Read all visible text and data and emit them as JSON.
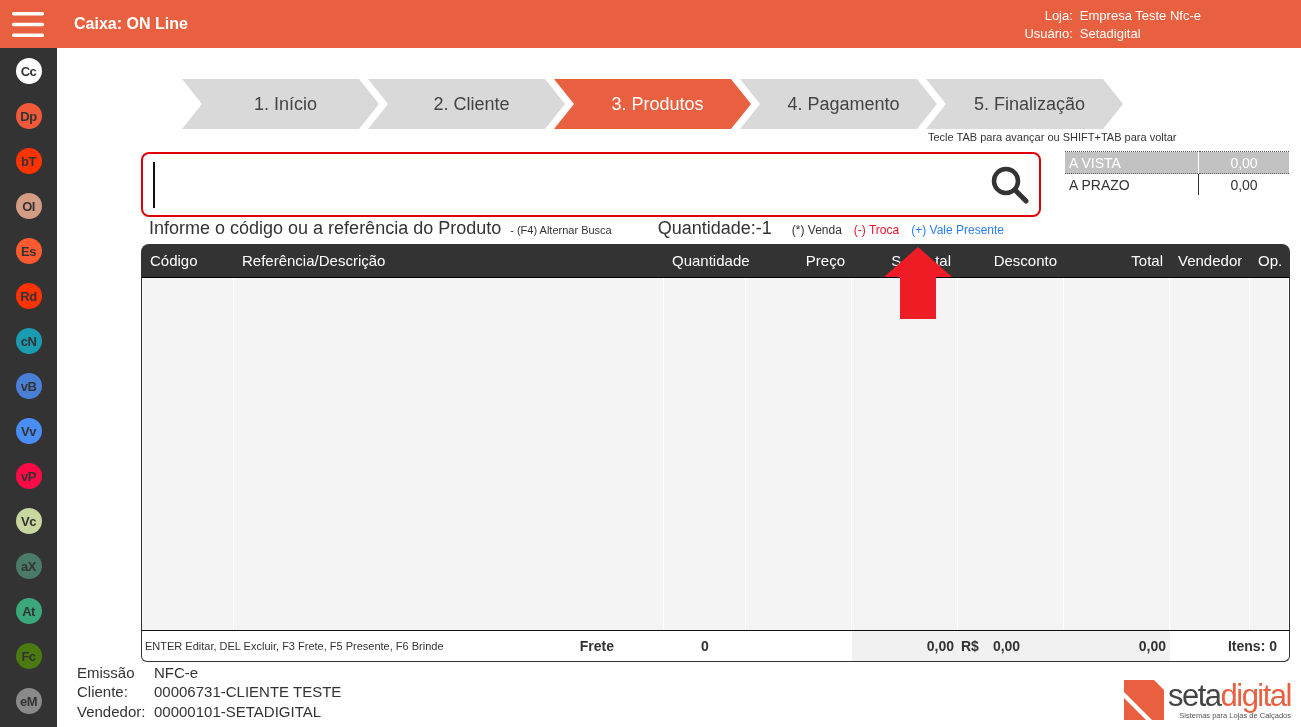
{
  "header": {
    "title": "Caixa: ON Line",
    "info": [
      {
        "label": "Loja:",
        "value": "Empresa Teste Nfc-e"
      },
      {
        "label": "Usuário:",
        "value": "Setadigital"
      }
    ]
  },
  "sidebar": {
    "items": [
      {
        "label": "Cc",
        "color": "#ffffff"
      },
      {
        "label": "Dp",
        "color": "#f05a3a"
      },
      {
        "label": "bT",
        "color": "#ff3300"
      },
      {
        "label": "Ol",
        "color": "#d49c84"
      },
      {
        "label": "Es",
        "color": "#ff5a30"
      },
      {
        "label": "Rd",
        "color": "#ff3300"
      },
      {
        "label": "cN",
        "color": "#1a9bb0"
      },
      {
        "label": "vB",
        "color": "#4a7fd8"
      },
      {
        "label": "Vv",
        "color": "#4a8ef5"
      },
      {
        "label": "vP",
        "color": "#ff0a46"
      },
      {
        "label": "Vc",
        "color": "#c8d6a0"
      },
      {
        "label": "aX",
        "color": "#4a7a68"
      },
      {
        "label": "At",
        "color": "#3aa87a"
      },
      {
        "label": "Fc",
        "color": "#4a7a10"
      },
      {
        "label": "eM",
        "color": "#8a8a8a"
      }
    ]
  },
  "steps": [
    {
      "label": "1. Início",
      "selected": false
    },
    {
      "label": "2. Cliente",
      "selected": false
    },
    {
      "label": "3. Produtos",
      "selected": true
    },
    {
      "label": "4. Pagamento",
      "selected": false
    },
    {
      "label": "5. Finalização",
      "selected": false
    }
  ],
  "steps_hint": "Tecle TAB para avançar ou SHIFT+TAB para voltar",
  "search": {
    "hint": "Informe o código ou a referência do Produto",
    "mode_hint": "- (F4) Alternar Busca",
    "quantity": "Quantidade:-1"
  },
  "legend": [
    {
      "label": "(*) Venda",
      "color": "#333333"
    },
    {
      "label": "(-) Troca",
      "color": "#e8102a"
    },
    {
      "label": "(+) Vale Presente",
      "color": "#2a7ff0"
    }
  ],
  "payment": [
    {
      "label": "A VISTA",
      "value": "0,00",
      "selected": true
    },
    {
      "label": "A PRAZO",
      "value": "0,00",
      "selected": false
    }
  ],
  "grid": {
    "columns": [
      {
        "label": "Código"
      },
      {
        "label": "Referência/Descrição"
      },
      {
        "label": "Quantidade"
      },
      {
        "label": "Preço"
      },
      {
        "label_parts": [
          "S",
          "tal"
        ]
      },
      {
        "label": "Desconto"
      },
      {
        "label": "Total"
      },
      {
        "label": "Vendedor"
      },
      {
        "label": "Op."
      }
    ],
    "footer": {
      "hint": "ENTER Editar, DEL Excluir, F3 Frete, F5 Presente, F6 Brinde",
      "freight_label": "Frete",
      "quantity": "0",
      "subtotal": "0,00",
      "currency": "R$",
      "discount": "0,00",
      "total": "0,00",
      "items": "Itens: 0"
    }
  },
  "emission": [
    {
      "label": "Emissão",
      "value": "NFC-e"
    },
    {
      "label": "Cliente:",
      "value": "00006731-CLIENTE TESTE"
    },
    {
      "label": "Vendedor:",
      "value": "00000101-SETADIGITAL"
    }
  ],
  "logo": {
    "part_a": "seta",
    "part_b": "digital",
    "tagline": "Sistemas para Lojas de Calçados"
  }
}
